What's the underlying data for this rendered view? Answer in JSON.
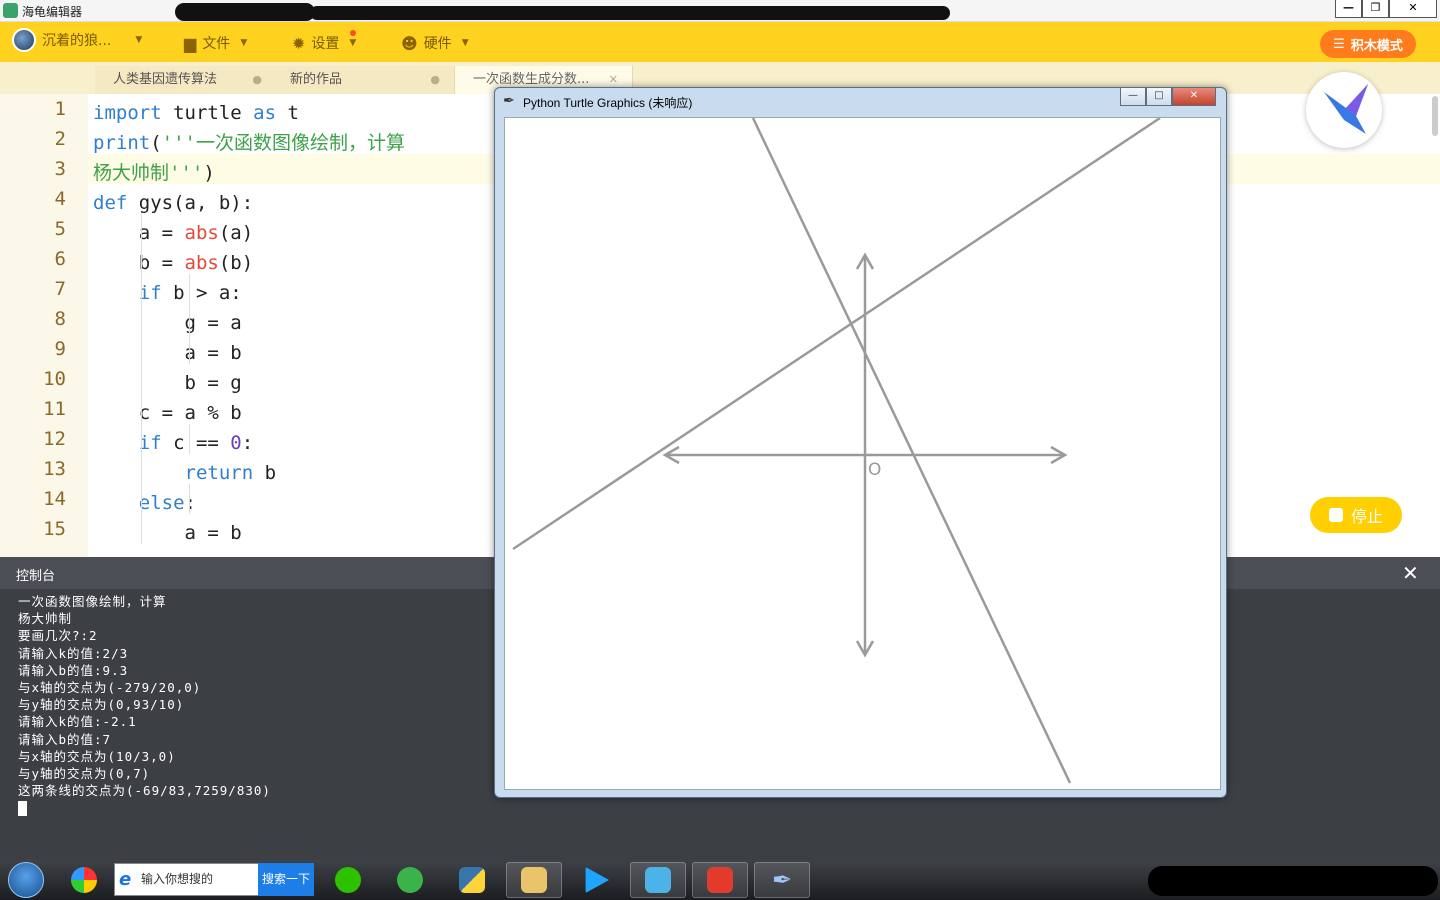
{
  "window": {
    "title": "海龟编辑器",
    "controls": {
      "minimize": "—",
      "maximize": "❐",
      "close": "✕"
    }
  },
  "toolbar": {
    "user_name": "沉着的狼...",
    "file_label": "文件",
    "settings_label": "设置",
    "hardware_label": "硬件",
    "blocks_mode_label": "积木模式"
  },
  "tabs": [
    {
      "label": "人类基因遗传算法",
      "close": "●"
    },
    {
      "label": "新的作品",
      "close": "●"
    },
    {
      "label": "一次函数生成分数...",
      "close": "✕"
    }
  ],
  "editor": {
    "line_numbers": [
      "1",
      "2",
      "3",
      "4",
      "5",
      "6",
      "7",
      "8",
      "9",
      "10",
      "11",
      "12",
      "13",
      "14",
      "15"
    ],
    "lines": [
      [
        {
          "t": "import",
          "c": "kw"
        },
        {
          "t": " turtle ",
          "c": ""
        },
        {
          "t": "as",
          "c": "kw"
        },
        {
          "t": " t",
          "c": ""
        }
      ],
      [
        {
          "t": "print",
          "c": "fn"
        },
        {
          "t": "(",
          "c": ""
        },
        {
          "t": "'''一次函数图像绘制，计算",
          "c": "st"
        }
      ],
      [
        {
          "t": "杨大帅制'''",
          "c": "st"
        },
        {
          "t": ")",
          "c": ""
        }
      ],
      [
        {
          "t": "def",
          "c": "kw"
        },
        {
          "t": " gys(a, b):",
          "c": ""
        }
      ],
      [
        {
          "t": "    a = ",
          "c": ""
        },
        {
          "t": "abs",
          "c": "bi"
        },
        {
          "t": "(a)",
          "c": ""
        }
      ],
      [
        {
          "t": "    b = ",
          "c": ""
        },
        {
          "t": "abs",
          "c": "bi"
        },
        {
          "t": "(b)",
          "c": ""
        }
      ],
      [
        {
          "t": "    ",
          "c": ""
        },
        {
          "t": "if",
          "c": "kw"
        },
        {
          "t": " b > a:",
          "c": ""
        }
      ],
      [
        {
          "t": "        g = a",
          "c": ""
        }
      ],
      [
        {
          "t": "        a = b",
          "c": ""
        }
      ],
      [
        {
          "t": "        b = g",
          "c": ""
        }
      ],
      [
        {
          "t": "    c = a % b",
          "c": ""
        }
      ],
      [
        {
          "t": "    ",
          "c": ""
        },
        {
          "t": "if",
          "c": "kw"
        },
        {
          "t": " c == ",
          "c": ""
        },
        {
          "t": "0",
          "c": "nm"
        },
        {
          "t": ":",
          "c": ""
        }
      ],
      [
        {
          "t": "        ",
          "c": ""
        },
        {
          "t": "return",
          "c": "kw"
        },
        {
          "t": " b",
          "c": ""
        }
      ],
      [
        {
          "t": "    ",
          "c": ""
        },
        {
          "t": "else",
          "c": "kw"
        },
        {
          "t": ":",
          "c": ""
        }
      ],
      [
        {
          "t": "        a = b",
          "c": ""
        }
      ]
    ],
    "stop_label": "停止"
  },
  "console": {
    "title": "控制台",
    "close": "✕",
    "lines": [
      "一次函数图像绘制，计算",
      "杨大帅制",
      "要画几次?:2",
      "请输入k的值:2/3",
      "请输入b的值:9.3",
      "与x轴的交点为(-279/20,0)",
      "与y轴的交点为(0,93/10)",
      "请输入k的值:-2.1",
      "请输入b的值:7",
      "与x轴的交点为(10/3,0)",
      "与y轴的交点为(0,7)",
      "这两条线的交点为(-69/83,7259/830)"
    ]
  },
  "turtle_window": {
    "title": "Python Turtle Graphics (未响应)",
    "origin_label": "O",
    "line_color": "#9a9a9a",
    "functions": [
      {
        "k": "2/3",
        "b": 9.3
      },
      {
        "k": -2.1,
        "b": 7
      }
    ]
  },
  "taskbar": {
    "search_placeholder": "输入你想搜的",
    "search_button": "搜索一下"
  },
  "colors": {
    "toolbar_bg": "#ffd21f",
    "accent_orange": "#ff7b1c",
    "console_bg": "#3c3f44",
    "keyword": "#2f7fd0",
    "string": "#3ea24a",
    "builtin": "#e44a3a"
  }
}
